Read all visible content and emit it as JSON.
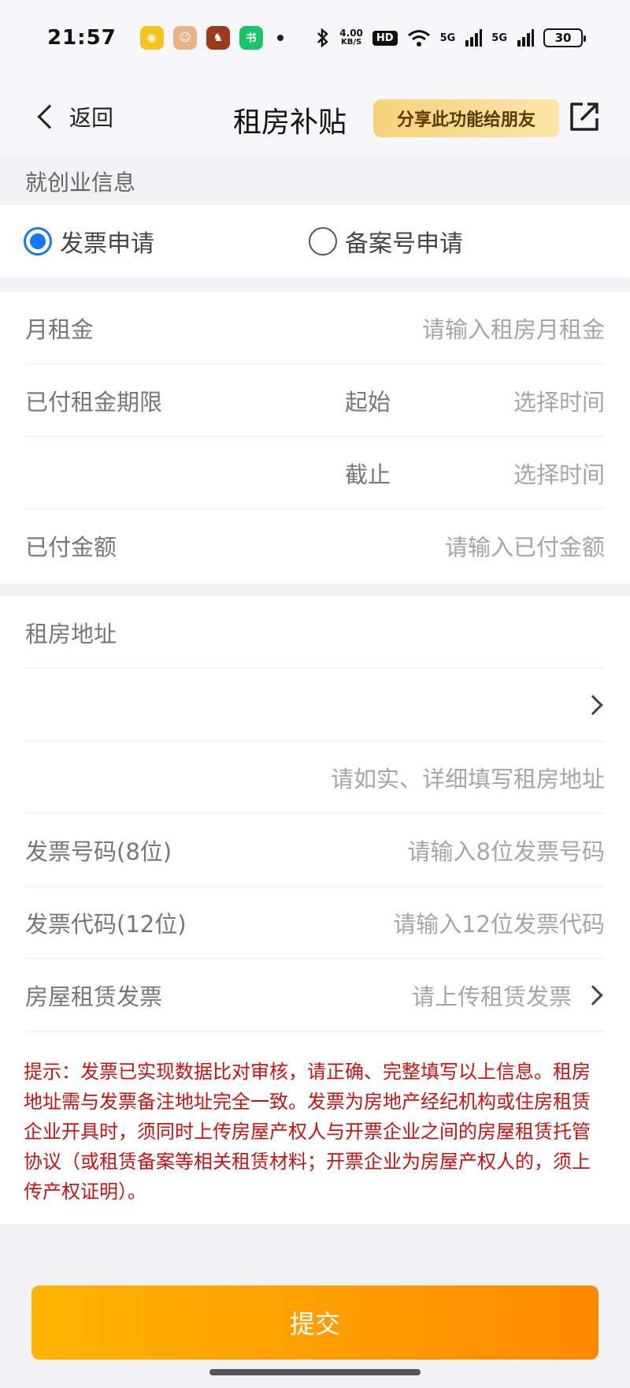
{
  "status_bar": {
    "time": "21:57",
    "apps": [
      {
        "icon": "weibo-icon",
        "color": "#f7c21b",
        "glyph": "◉"
      },
      {
        "icon": "avatar-app-icon",
        "color": "#e9b38a",
        "glyph": "☺"
      },
      {
        "icon": "game-app-icon",
        "color": "#9b3a1c",
        "glyph": "♞"
      },
      {
        "icon": "novel-app-icon",
        "color": "#18c36a",
        "glyph": "书"
      }
    ],
    "net_speed_value": "4.00",
    "net_speed_unit": "KB/S",
    "hd_label": "HD",
    "signal1": "5G",
    "signal2": "5G",
    "battery": "30"
  },
  "nav": {
    "back_label": "返回",
    "title": "租房补贴",
    "share_label": "分享此功能给朋友"
  },
  "section": {
    "title": "就创业信息"
  },
  "radio": {
    "options": [
      {
        "label": "发票申请",
        "checked": true
      },
      {
        "label": "备案号申请",
        "checked": false
      }
    ]
  },
  "form1": {
    "monthly_rent_label": "月租金",
    "monthly_rent_placeholder": "请输入租房月租金",
    "paid_period_label": "已付租金期限",
    "start_label": "起始",
    "start_placeholder": "选择时间",
    "end_label": "截止",
    "end_placeholder": "选择时间",
    "paid_amount_label": "已付金额",
    "paid_amount_placeholder": "请输入已付金额"
  },
  "form2": {
    "address_label": "租房地址",
    "address_detail_placeholder": "请如实、详细填写租房地址",
    "invoice_number_label": "发票号码(8位)",
    "invoice_number_placeholder": "请输入8位发票号码",
    "invoice_code_label": "发票代码(12位)",
    "invoice_code_placeholder": "请输入12位发票代码",
    "rental_invoice_label": "房屋租赁发票",
    "rental_invoice_placeholder": "请上传租赁发票"
  },
  "hint": "提示：发票已实现数据比对审核，请正确、完整填写以上信息。租房地址需与发票备注地址完全一致。发票为房地产经纪机构或住房租赁企业开具时，须同时上传房屋产权人与开票企业之间的房屋租赁托管协议（或租赁备案等相关租赁材料；开票企业为房屋产权人的，须上传产权证明）。",
  "submit_label": "提交"
}
